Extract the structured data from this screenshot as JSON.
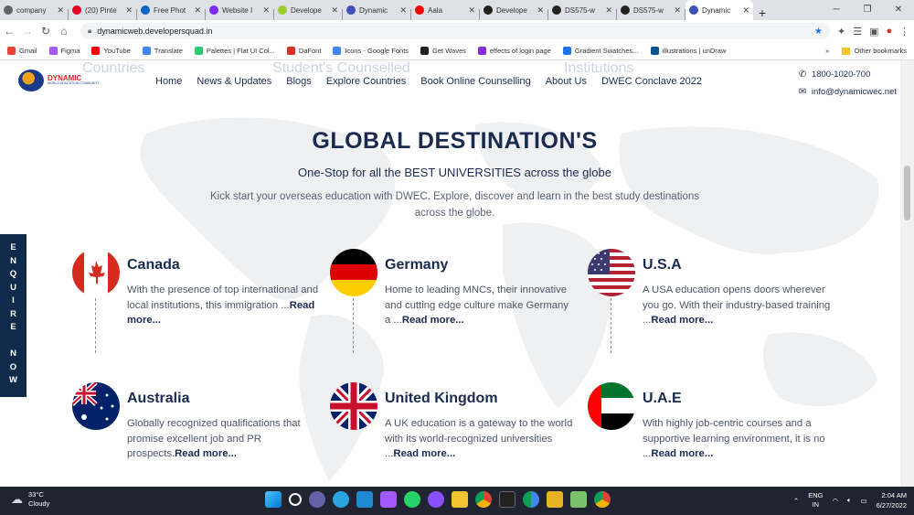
{
  "browser": {
    "tabs": [
      {
        "label": "company",
        "color": "#5f6368"
      },
      {
        "label": "(20) Pinte",
        "color": "#e60023"
      },
      {
        "label": "Free Phot",
        "color": "#0a66c2"
      },
      {
        "label": "Website I",
        "color": "#7b2ff7"
      },
      {
        "label": "Develope",
        "color": "#9acd32"
      },
      {
        "label": "Dynamic",
        "color": "#3f51b5"
      },
      {
        "label": "Aala",
        "color": "#ff0000"
      },
      {
        "label": "Develope",
        "color": "#222222"
      },
      {
        "label": "DS575-w",
        "color": "#222222"
      },
      {
        "label": "DS575-w",
        "color": "#222222"
      },
      {
        "label": "Dynamic",
        "color": "#3f51b5"
      }
    ],
    "url": "dynamicweb.developersquad.in",
    "bookmarks": [
      "Gmail",
      "Figma",
      "YouTube",
      "Translate",
      "Palettes | Flat UI Col...",
      "DaFont",
      "Icons - Google Fonts",
      "Get Waves",
      "effects of login page",
      "Gradient Swatches...",
      "Illustrations | unDraw"
    ],
    "other_bookmarks": "Other bookmarks"
  },
  "site": {
    "logo_line1": "DYNAMIC",
    "logo_line2": "WORLD EDUCATION COMMUNITY",
    "ghost_texts": [
      "Countries",
      "Student's Counselled",
      "Institutions"
    ],
    "nav": [
      "Home",
      "News & Updates",
      "Blogs",
      "Explore Countries",
      "Book Online Counselling",
      "About Us",
      "DWEC Conclave 2022"
    ],
    "phone": "1800-1020-700",
    "email": "info@dynamicwec.net"
  },
  "main": {
    "heading": "GLOBAL DESTINATION'S",
    "subheading": "One-Stop for all the BEST UNIVERSITIES across the globe",
    "intro": "Kick start your overseas education with DWEC. Explore, discover and learn in the best study destinations across the globe.",
    "enquire_letters": [
      "E",
      "N",
      "Q",
      "U",
      "I",
      "R",
      "E",
      "",
      "N",
      "O",
      "W"
    ],
    "destinations": [
      {
        "name": "Canada",
        "desc": "With the presence of top international and local institutions, this immigration ...",
        "more": "Read more..."
      },
      {
        "name": "Germany",
        "desc": "Home to leading MNCs, their innovative and cutting edge culture make Germany a ...",
        "more": "Read more..."
      },
      {
        "name": "U.S.A",
        "desc": "A USA education opens doors wherever you go. With their industry-based training ...",
        "more": "Read more..."
      },
      {
        "name": "Australia",
        "desc": "Globally recognized qualifications that promise excellent job and PR prospects.",
        "more": "Read more..."
      },
      {
        "name": "United Kingdom",
        "desc": "A UK education is a gateway to the world with its world-recognized universities ...",
        "more": "Read more..."
      },
      {
        "name": "U.A.E",
        "desc": "With highly job-centric courses and a supportive learning environment, it is no ...",
        "more": "Read more..."
      }
    ]
  },
  "taskbar": {
    "temp": "33°C",
    "weather": "Cloudy",
    "lang1": "ENG",
    "lang2": "IN",
    "time": "2:04 AM",
    "date": "6/27/2022"
  }
}
